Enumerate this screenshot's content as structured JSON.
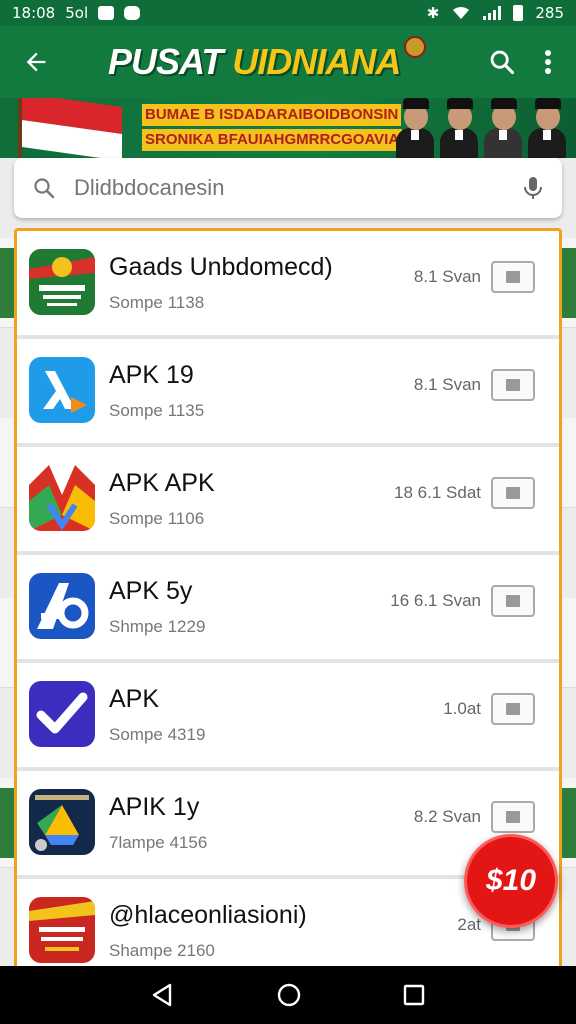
{
  "status_bar": {
    "time": "18:08",
    "extra": "5ol",
    "battery": "285"
  },
  "header": {
    "title_part1": "PUSAT",
    "title_part2": "UIDNIANA"
  },
  "banner": {
    "line1": "BUMAE B ISDADARAIBOIDBONSIN",
    "line2": "SRONIKA BFAUIAHGMRRCGOAVIA"
  },
  "search": {
    "placeholder": "Dlidbdocanesin"
  },
  "apps": [
    {
      "name": "Gaads Unbdomecd)",
      "subtitle": "Sompe 1138",
      "size": "8.1 Svan",
      "icon": "green-seal-icon"
    },
    {
      "name": "APK 19",
      "subtitle": "Sompe 1135",
      "size": "8.1 Svan",
      "icon": "lambda-play-icon"
    },
    {
      "name": "APK APK",
      "subtitle": "Sompe 1106",
      "size": "18 6.1 Sdat",
      "icon": "maps-icon"
    },
    {
      "name": "APK 5y",
      "subtitle": "Shmpe 1229",
      "size": "16 6.1 Svan",
      "icon": "a-letter-icon"
    },
    {
      "name": "APK",
      "subtitle": "Sompe 4319",
      "size": "1.0at",
      "icon": "checkmark-icon"
    },
    {
      "name": "APIK 1y",
      "subtitle": "7lampe 4156",
      "size": "8.2 Svan",
      "icon": "drive-icon"
    },
    {
      "name": "@hlaceonliasioni)",
      "subtitle": "Shampe 2160",
      "size": "2at",
      "icon": "red-seal-icon"
    }
  ],
  "fab": {
    "label": "$10"
  },
  "colors": {
    "primary": "#137a3f",
    "accent": "#f0a21b",
    "fab": "#e31515"
  }
}
